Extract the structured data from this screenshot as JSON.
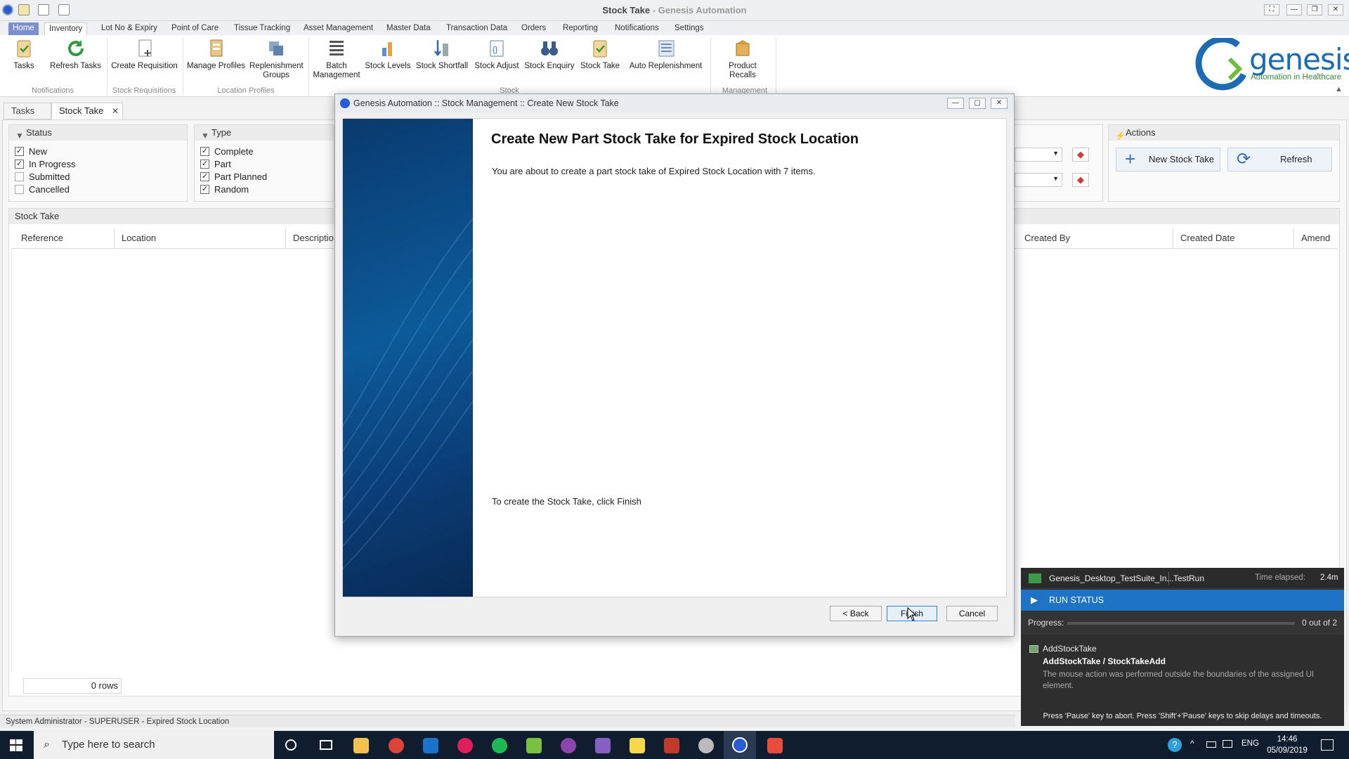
{
  "window": {
    "title": "Stock Take",
    "app_name": "Genesis Automation",
    "title_separator": "-"
  },
  "menu_tabs": [
    "Home",
    "Inventory",
    "Lot No & Expiry",
    "Point of Care",
    "Tissue Tracking",
    "Asset Management",
    "Master Data",
    "Transaction Data",
    "Orders",
    "Reporting",
    "Notifications",
    "Settings"
  ],
  "ribbon": {
    "buttons": [
      "Tasks",
      "Refresh Tasks",
      "Create Requisition",
      "Manage Profiles",
      "Replenishment Groups",
      "Batch Management",
      "Stock Levels",
      "Stock Shortfall",
      "Stock Adjust",
      "Stock Enquiry",
      "Stock Take",
      "Auto Replenishment",
      "Product Recalls"
    ],
    "groups": [
      "Notifications",
      "Stock Requisitions",
      "Location Profiles",
      "Stock",
      "Management"
    ]
  },
  "logo": {
    "name": "genesis",
    "tagline": "Automation in Healthcare",
    "brand_color": "#1c6bb3",
    "accent_color": "#6fbf3a"
  },
  "doc_tabs": {
    "tasks": "Tasks",
    "stock_take": "Stock Take",
    "close": "✕"
  },
  "status_filter": {
    "title": "Status",
    "items": [
      {
        "label": "New",
        "checked": true
      },
      {
        "label": "In Progress",
        "checked": true
      },
      {
        "label": "Submitted",
        "checked": false
      },
      {
        "label": "Cancelled",
        "checked": false
      }
    ]
  },
  "type_filter": {
    "title": "Type",
    "items": [
      {
        "label": "Complete",
        "checked": true
      },
      {
        "label": "Part",
        "checked": true
      },
      {
        "label": "Part Planned",
        "checked": true
      },
      {
        "label": "Random",
        "checked": true
      }
    ]
  },
  "actions": {
    "title": "Actions",
    "new_stock_take": "New Stock Take",
    "refresh": "Refresh"
  },
  "grid": {
    "title": "Stock Take",
    "columns": [
      "Reference",
      "Location",
      "Descriptio",
      "Created By",
      "Created Date",
      "Amend"
    ],
    "row_count": "0 rows"
  },
  "dialog": {
    "title": "Genesis Automation :: Stock Management :: Create New Stock Take",
    "heading": "Create New Part Stock Take for Expired Stock Location",
    "message": "You are about to create a part stock take of Expired Stock Location with 7 items.",
    "finish_message": "To create the Stock Take, click Finish",
    "back": "< Back",
    "finish": "Finish",
    "cancel": "Cancel"
  },
  "run_status": {
    "suite": "Genesis_Desktop_TestSuite_In...",
    "run": "TestRun",
    "elapsed_label": "Time elapsed:",
    "elapsed": "2.4m",
    "header": "RUN STATUS",
    "progress_label": "Progress:",
    "progress_text": "0 out of 2",
    "progress_fraction": 0,
    "item_name": "AddStockTake",
    "item_path": "AddStockTake / StockTakeAdd",
    "item_message": "The mouse action was performed outside the boundaries of the assigned UI element.",
    "footer": "Press 'Pause' key to abort. Press 'Shift'+'Pause' keys to skip delays and timeouts."
  },
  "status_bar": {
    "text": "System Administrator - SUPERUSER - Expired Stock Location"
  },
  "taskbar": {
    "search_placeholder": "Type here to search",
    "lang": "ENG",
    "time": "14:46",
    "date": "05/09/2019"
  }
}
